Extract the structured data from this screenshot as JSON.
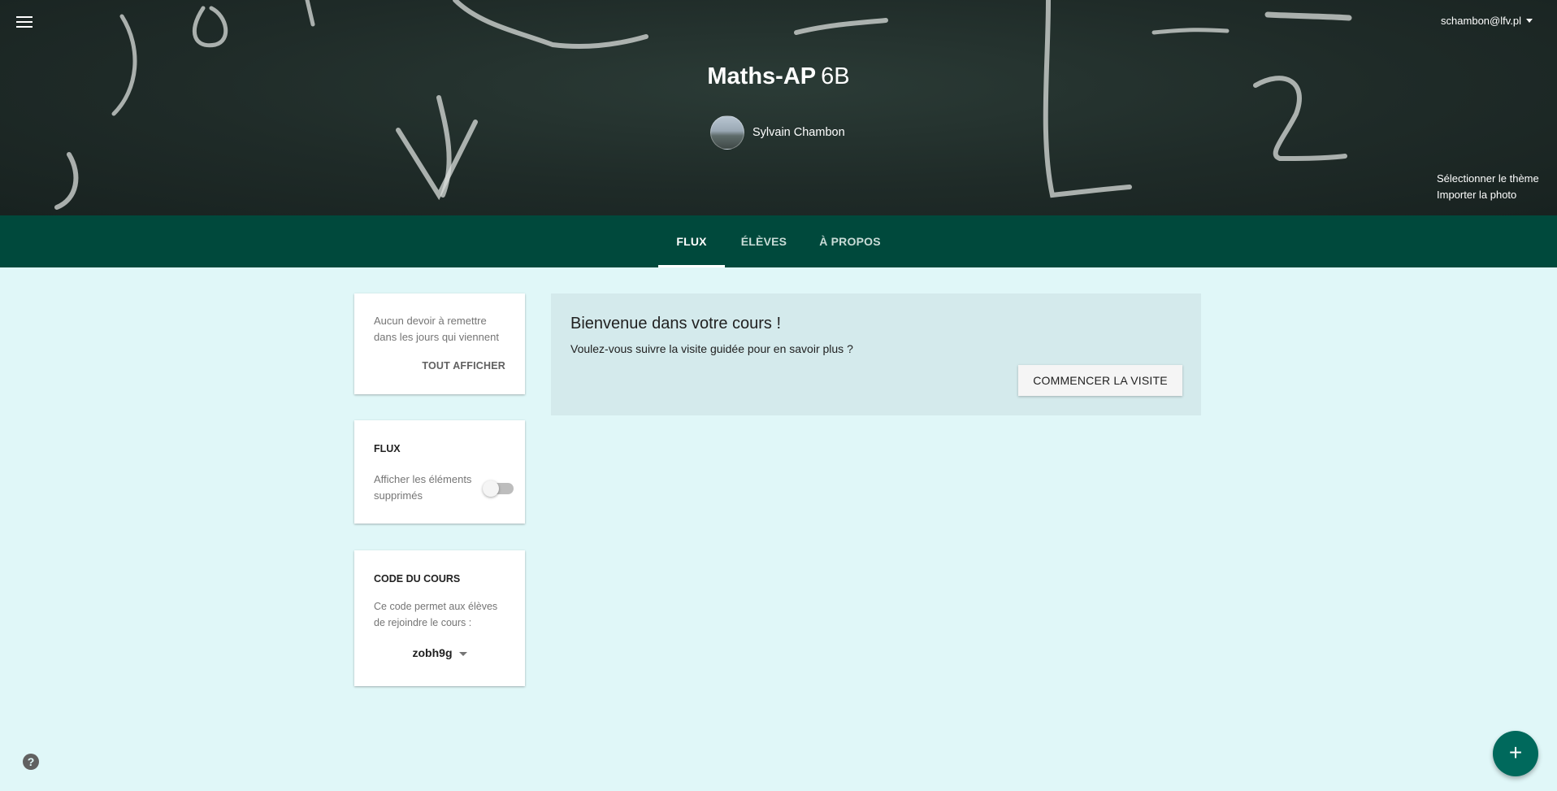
{
  "account": {
    "email": "schambon@lfv.pl"
  },
  "course": {
    "name": "Maths-AP",
    "section": "6B",
    "teacher": "Sylvain Chambon"
  },
  "banner_actions": {
    "select_theme": "Sélectionner le thème",
    "upload_photo": "Importer la photo"
  },
  "tabs": [
    {
      "label": "FLUX",
      "active": true
    },
    {
      "label": "ÉLÈVES",
      "active": false
    },
    {
      "label": "À PROPOS",
      "active": false
    }
  ],
  "upcoming": {
    "text": "Aucun devoir à remettre dans les jours qui viennent",
    "view_all": "TOUT AFFICHER"
  },
  "stream_settings": {
    "heading": "FLUX",
    "show_deleted_label": "Afficher les éléments supprimés",
    "show_deleted": false
  },
  "class_code": {
    "heading": "CODE DU COURS",
    "description": "Ce code permet aux élèves de rejoindre le cours :",
    "code": "zobh9g"
  },
  "welcome": {
    "title": "Bienvenue dans votre cours !",
    "subtitle": "Voulez-vous suivre la visite guidée pour en savoir plus ?",
    "tour_button": "COMMENCER LA VISITE"
  },
  "icons": {
    "menu": "hamburger-menu-icon",
    "help": "help-icon",
    "fab": "plus-icon"
  },
  "colors": {
    "tab_bar": "#00493c",
    "background": "#e0f7f8",
    "fab": "#00695c",
    "welcome_bg": "#d4eaec"
  }
}
